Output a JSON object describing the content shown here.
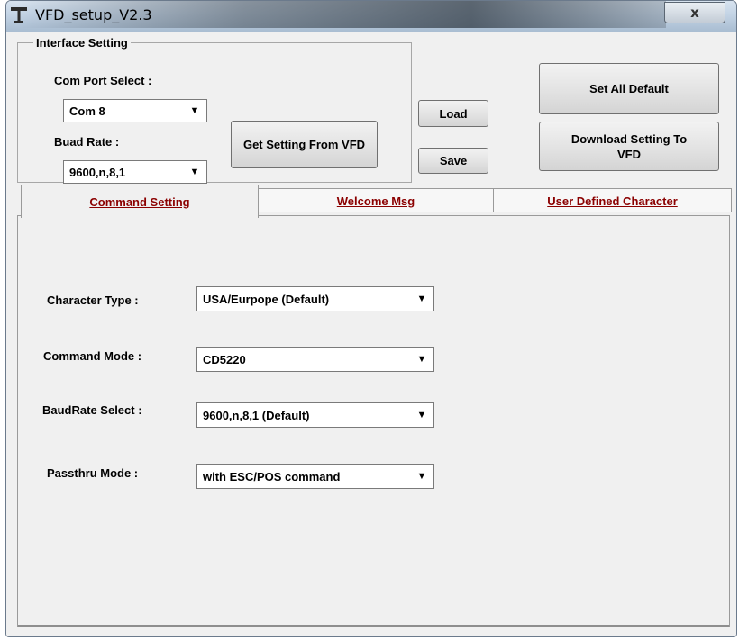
{
  "window": {
    "title": "VFD_setup_V2.3",
    "close_label": "x"
  },
  "interface": {
    "legend": "Interface Setting",
    "com_port_label": "Com Port Select :",
    "com_port_value": "Com 8",
    "baud_rate_label": "Buad Rate :",
    "baud_rate_value": "9600,n,8,1",
    "get_setting_label": "Get Setting From VFD"
  },
  "actions": {
    "load_label": "Load",
    "save_label": "Save",
    "set_all_default_label": "Set All Default",
    "download_label": "Download Setting To VFD"
  },
  "tabs": [
    {
      "label": "Command Setting",
      "active": true
    },
    {
      "label": "Welcome Msg",
      "active": false
    },
    {
      "label": "User Defined Character",
      "active": false
    }
  ],
  "command": {
    "character_type_label": "Character Type :",
    "character_type_value": "USA/Eurpope  (Default)",
    "command_mode_label": "Command Mode :",
    "command_mode_value": "CD5220",
    "baudrate_select_label": "BaudRate Select :",
    "baudrate_select_value": "9600,n,8,1 (Default)",
    "passthru_label": "Passthru Mode :",
    "passthru_value": "with ESC/POS command"
  },
  "icons": {
    "app": "app-icon",
    "dropdown": "chevron-down-icon"
  },
  "colors": {
    "tab_text": "#8b0000",
    "window_bg": "#f0f0f0"
  }
}
